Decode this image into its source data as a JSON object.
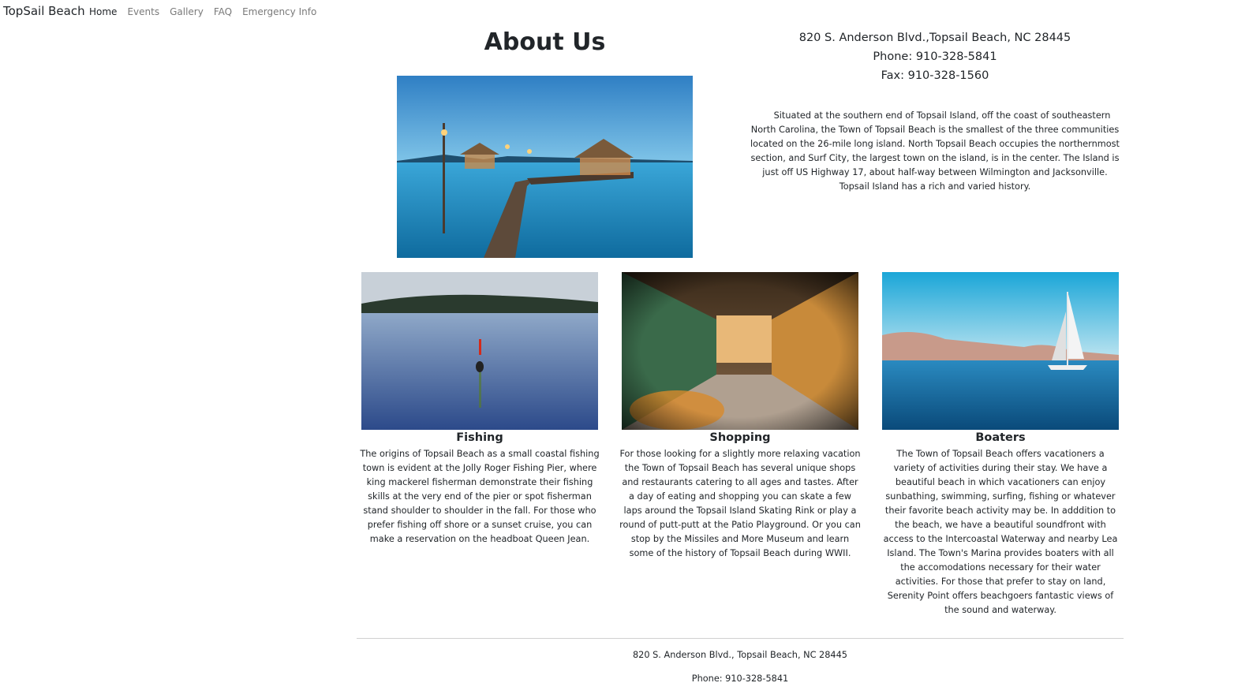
{
  "nav": {
    "brand": "TopSail Beach",
    "links": [
      "Home",
      "Events",
      "Gallery",
      "FAQ",
      "Emergency Info"
    ],
    "active": "Home"
  },
  "about": {
    "title": "About Us",
    "address": "820 S. Anderson Blvd.,Topsail Beach, NC 28445",
    "phone": "Phone: 910-328-5841",
    "fax": "Fax: 910-328-1560",
    "intro": "Situated at the southern end of Topsail Island, off the coast of southeastern North Carolina, the Town of Topsail Beach is the smallest of the three communities located on the 26-mile long island. North Topsail Beach occupies the northernmost section, and Surf City, the largest town on the island, is in the center. The Island is just off US Highway 17, about half-way between Wilmington and Jacksonville. Topsail Island has a rich and varied history."
  },
  "cards": [
    {
      "title": "Fishing",
      "text": "The origins of Topsail Beach as a small coastal fishing town is evident at the Jolly Roger Fishing Pier, where king mackerel fisherman demonstrate their fishing skills at the very end of the pier or spot fisherman stand shoulder to shoulder in the fall. For those who prefer fishing off shore or a sunset cruise, you can make a reservation on the headboat Queen Jean."
    },
    {
      "title": "Shopping",
      "text": "For those looking for a slightly more relaxing vacation the Town of Topsail Beach has several unique shops and restaurants catering to all ages and tastes. After a day of eating and shopping you can skate a few laps around the Topsail Island Skating Rink or play a round of putt-putt at the Patio Playground. Or you can stop by the Missiles and More Museum and learn some of the history of Topsail Beach during WWII."
    },
    {
      "title": "Boaters",
      "text": "The Town of Topsail Beach offers vacationers a variety of activities during their stay. We have a beautiful beach in which vacationers can enjoy sunbathing, swimming, surfing, fishing or whatever their favorite beach activity may be. In adddition to the beach, we have a beautiful soundfront with access to the Intercoastal Waterway and nearby Lea Island. The Town's Marina provides boaters with all the accomodations necessary for their water activities. For those that prefer to stay on land, Serenity Point offers beachgoers fantastic views of the sound and waterway."
    }
  ],
  "footer": {
    "address": "820 S. Anderson Blvd., Topsail Beach, NC 28445",
    "phone": "Phone: 910-328-5841"
  }
}
